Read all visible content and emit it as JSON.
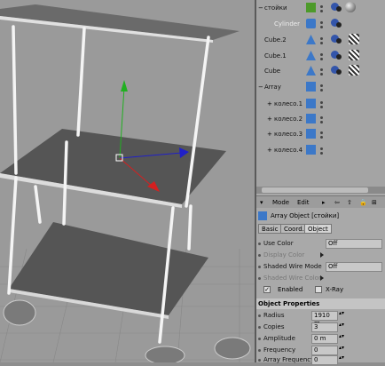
{
  "object_manager": {
    "items": [
      {
        "name": "стойки",
        "indent": 0,
        "expand": "−",
        "icon": "null-object-icon",
        "icon_color": "#4d9a2a"
      },
      {
        "name": "Cylinder",
        "indent": 1,
        "expand": "",
        "icon": "cylinder-icon",
        "icon_color": "#3c78c8"
      },
      {
        "name": "Cube.2",
        "indent": 0,
        "expand": "",
        "icon": "cube-icon",
        "icon_color": "#3c78c8"
      },
      {
        "name": "Cube.1",
        "indent": 0,
        "expand": "",
        "icon": "cube-icon",
        "icon_color": "#3c78c8"
      },
      {
        "name": "Cube",
        "indent": 0,
        "expand": "",
        "icon": "cube-icon",
        "icon_color": "#3c78c8"
      },
      {
        "name": "Array",
        "indent": 0,
        "expand": "−",
        "icon": "array-icon",
        "icon_color": "#3c78c8"
      },
      {
        "name": "колесо.1",
        "indent": 1,
        "expand": "+",
        "icon": "array-icon",
        "icon_color": "#3c78c8"
      },
      {
        "name": "колесо.2",
        "indent": 1,
        "expand": "+",
        "icon": "array-icon",
        "icon_color": "#3c78c8"
      },
      {
        "name": "колесо.3",
        "indent": 1,
        "expand": "+",
        "icon": "array-icon",
        "icon_color": "#3c78c8"
      },
      {
        "name": "колесо.4",
        "indent": 1,
        "expand": "+",
        "icon": "array-icon",
        "icon_color": "#3c78c8"
      }
    ]
  },
  "attribute_manager": {
    "menu": {
      "mode": "Mode",
      "edit": "Edit"
    },
    "title": "Array Object [стойки]",
    "tabs": [
      "Basic",
      "Coord.",
      "Object"
    ],
    "active_tab": "Object",
    "basic_props": [
      {
        "label": "Use Color",
        "value": "Off",
        "dim": false
      },
      {
        "label": "Display Color",
        "value": "",
        "dim": true
      },
      {
        "label": "Shaded Wire Mode",
        "value": "Off",
        "dim": false
      },
      {
        "label": "Shaded Wire Color",
        "value": "",
        "dim": true
      }
    ],
    "enabled_label": "Enabled",
    "xray_label": "X-Ray",
    "section_title": "Object Properties",
    "object_props": [
      {
        "label": "Radius",
        "value": "1910 m"
      },
      {
        "label": "Copies",
        "value": "3"
      },
      {
        "label": "Amplitude",
        "value": "0 m"
      },
      {
        "label": "Frequency",
        "value": "0"
      },
      {
        "label": "Array Frequency",
        "value": "0"
      }
    ]
  },
  "colors": {
    "viewport_bg": "#9a9a9a",
    "axis_x": "#d42020",
    "axis_y": "#20b020",
    "axis_z": "#2020c8",
    "shelf": "#555555",
    "pole": "#f4f4f4"
  }
}
